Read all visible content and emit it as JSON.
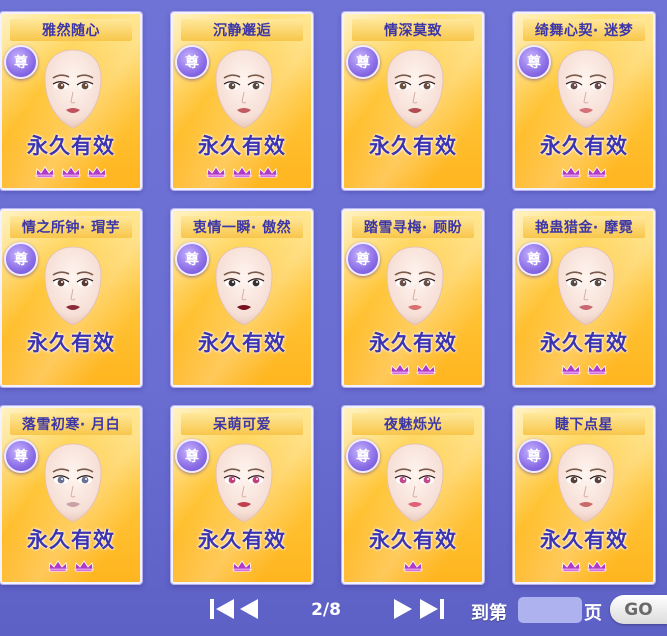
{
  "badge_label": "尊",
  "validity_label": "永久有效",
  "cards": [
    {
      "name": "雅然随心",
      "crowns": 3,
      "lip_color": "#c0545e",
      "eye_color": "#6b4a3a"
    },
    {
      "name": "沉静邂逅",
      "crowns": 3,
      "lip_color": "#c25a62",
      "eye_color": "#5a4a40"
    },
    {
      "name": "情深莫致",
      "crowns": 0,
      "lip_color": "#b24b54",
      "eye_color": "#6a5040"
    },
    {
      "name": "绮舞心契· 迷梦",
      "crowns": 2,
      "lip_color": "#d6707a",
      "eye_color": "#6b4a4a"
    },
    {
      "name": "情之所钟· 瑁芋",
      "crowns": 0,
      "lip_color": "#8a2a3a",
      "eye_color": "#5a3a30"
    },
    {
      "name": "衷情一瞬· 傲然",
      "crowns": 0,
      "lip_color": "#7a1020",
      "eye_color": "#3a3030"
    },
    {
      "name": "踏雪寻梅· 顾盼",
      "crowns": 2,
      "lip_color": "#d87070",
      "eye_color": "#6a5048"
    },
    {
      "name": "艳蛊猎金· 摩霓",
      "crowns": 2,
      "lip_color": "#c86872",
      "eye_color": "#5a4a44"
    },
    {
      "name": "落雪初寒· 月白",
      "crowns": 2,
      "lip_color": "#c8a0a8",
      "eye_color": "#6a7090"
    },
    {
      "name": "呆萌可爱",
      "crowns": 1,
      "lip_color": "#c04050",
      "eye_color": "#c0407a"
    },
    {
      "name": "夜魅烁光",
      "crowns": 1,
      "lip_color": "#e0607a",
      "eye_color": "#c04a8a"
    },
    {
      "name": "睫下点星",
      "crowns": 2,
      "lip_color": "#c86a6a",
      "eye_color": "#5a4038"
    }
  ],
  "pager": {
    "page": "2/8",
    "goto_label": "到第",
    "page_input_value": "",
    "page_suffix": "页",
    "go_label": "GO"
  }
}
